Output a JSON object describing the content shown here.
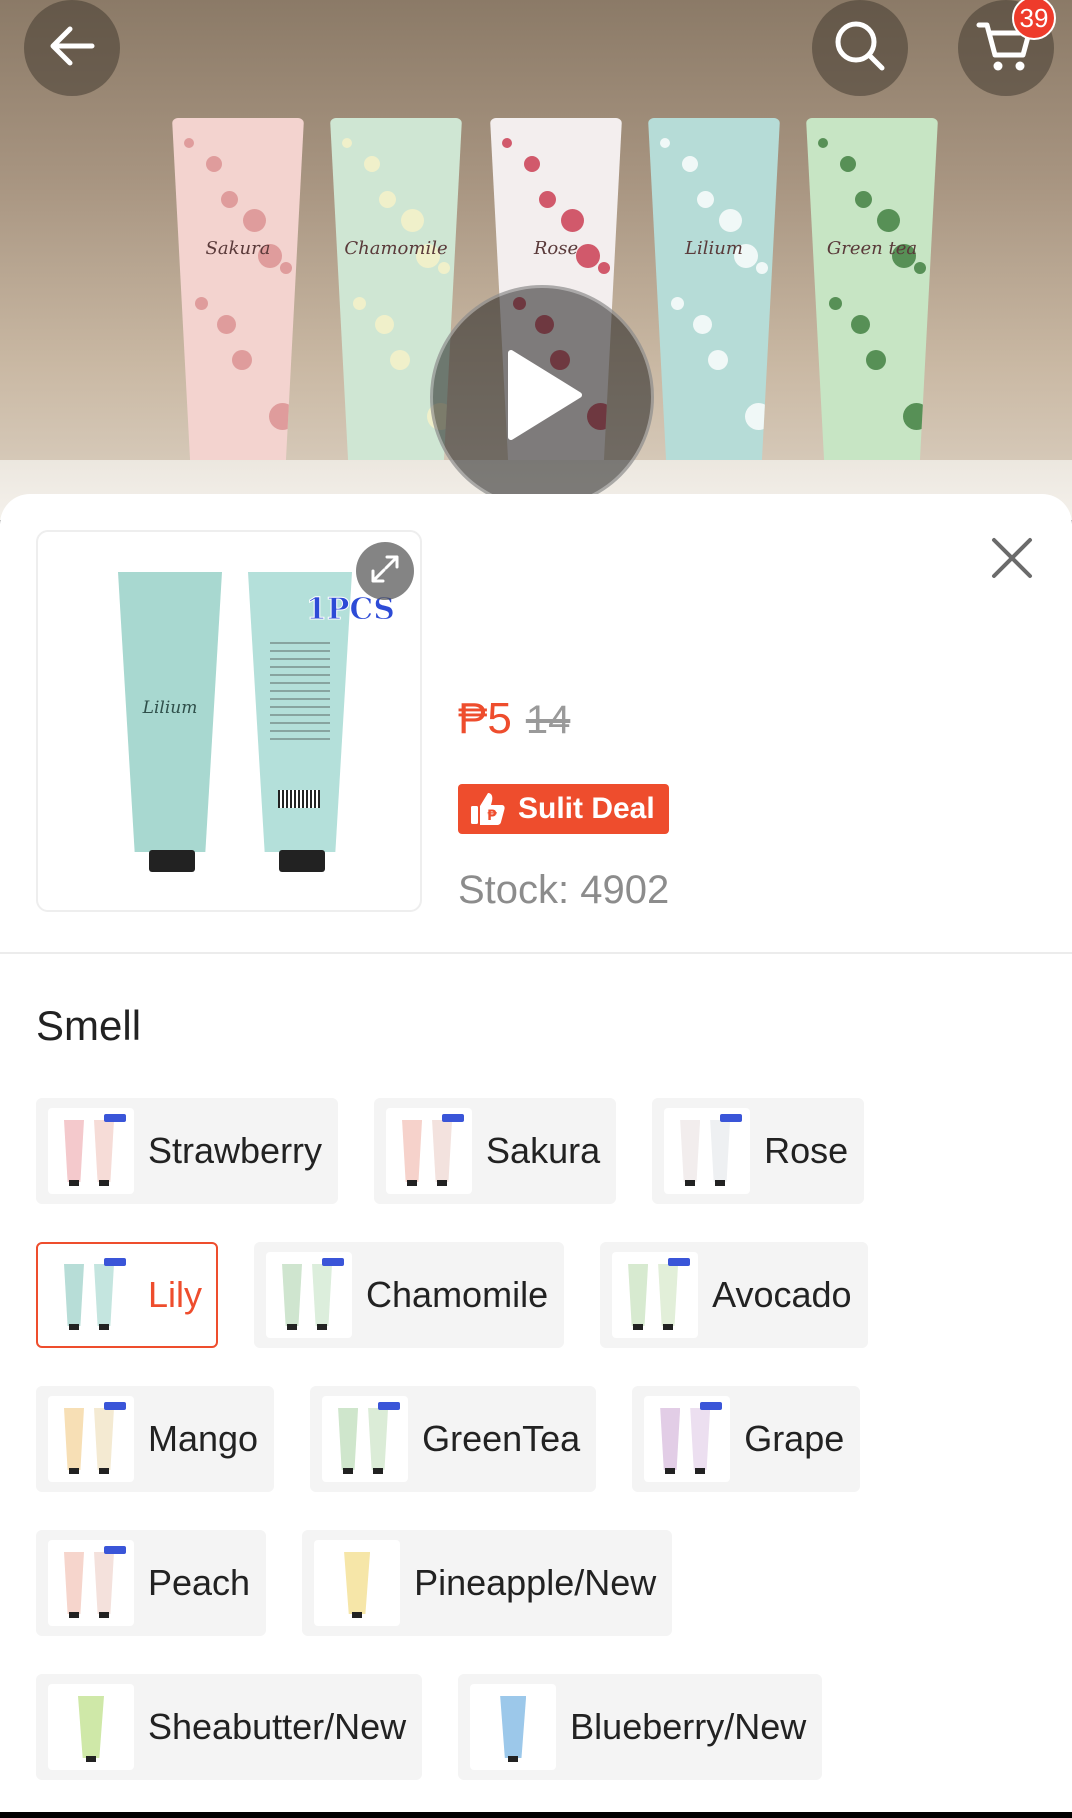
{
  "header": {
    "back_icon": "arrow-left-icon",
    "search_icon": "search-icon",
    "cart_icon": "cart-icon",
    "cart_count": "39"
  },
  "banner": {
    "tubes": [
      {
        "label": "Sakura",
        "color": "#f3d3cf"
      },
      {
        "label": "Chamomile",
        "color": "#cfe6d3"
      },
      {
        "label": "Rose",
        "color": "#f3eeee"
      },
      {
        "label": "Lilium",
        "color": "#b6dcd7"
      },
      {
        "label": "Green tea",
        "color": "#c7e5c4"
      }
    ],
    "play_icon": "play-icon"
  },
  "product": {
    "thumb_tag": "1PCS",
    "thumb_label": "Lilium",
    "price": "₱5",
    "original_price": "14",
    "deal_label": "Sulit Deal",
    "stock": "Stock: 4902"
  },
  "variation": {
    "title": "Smell",
    "rows": [
      [
        {
          "label": "Strawberry",
          "color1": "#f4c9cc",
          "color2": "#f6dcd7",
          "selected": false
        },
        {
          "label": "Sakura",
          "color1": "#f6d2cb",
          "color2": "#f3e2de",
          "selected": false
        },
        {
          "label": "Rose",
          "color1": "#f2eded",
          "color2": "#eef0f2",
          "selected": false
        }
      ],
      [
        {
          "label": "Lily",
          "color1": "#b7ddd7",
          "color2": "#c4e5df",
          "selected": true
        },
        {
          "label": "Chamomile",
          "color1": "#cfe5cf",
          "color2": "#dceedc",
          "selected": false
        },
        {
          "label": "Avocado",
          "color1": "#d7ead0",
          "color2": "#e2efd9",
          "selected": false
        }
      ],
      [
        {
          "label": "Mango",
          "color1": "#f7dfb5",
          "color2": "#f4ead2",
          "selected": false
        },
        {
          "label": "GreenTea",
          "color1": "#cfe6cc",
          "color2": "#dbecd7",
          "selected": false
        },
        {
          "label": "Grape",
          "color1": "#e2cde6",
          "color2": "#ecdff0",
          "selected": false
        }
      ],
      [
        {
          "label": "Peach",
          "color1": "#f6d5cc",
          "color2": "#f4e1dc",
          "selected": false
        },
        {
          "label": "Pineapple/New",
          "color1": "#f6e6a8",
          "color2": "",
          "selected": false
        }
      ],
      [
        {
          "label": "Sheabutter/New",
          "color1": "#cfe8a8",
          "color2": "",
          "selected": false
        },
        {
          "label": "Blueberry/New",
          "color1": "#9cc8ea",
          "color2": "",
          "selected": false
        }
      ]
    ]
  },
  "colors": {
    "accent": "#ee4d2d",
    "badge": "#ee3b2b",
    "muted_text": "#8c8c8c",
    "chip_bg": "#f4f4f4"
  }
}
